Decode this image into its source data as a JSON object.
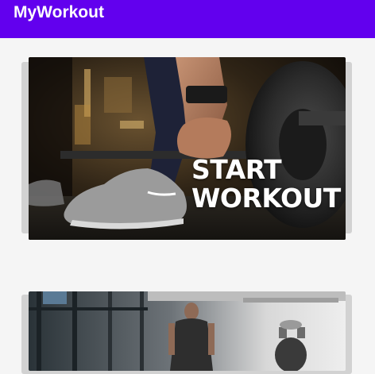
{
  "app_bar": {
    "title": "MyWorkout",
    "color": "#6200ee"
  },
  "cards": [
    {
      "label": "START\nWORKOUT",
      "image": "barbell-deadlift-photo"
    },
    {
      "label": "",
      "image": "gym-training-photo"
    }
  ]
}
